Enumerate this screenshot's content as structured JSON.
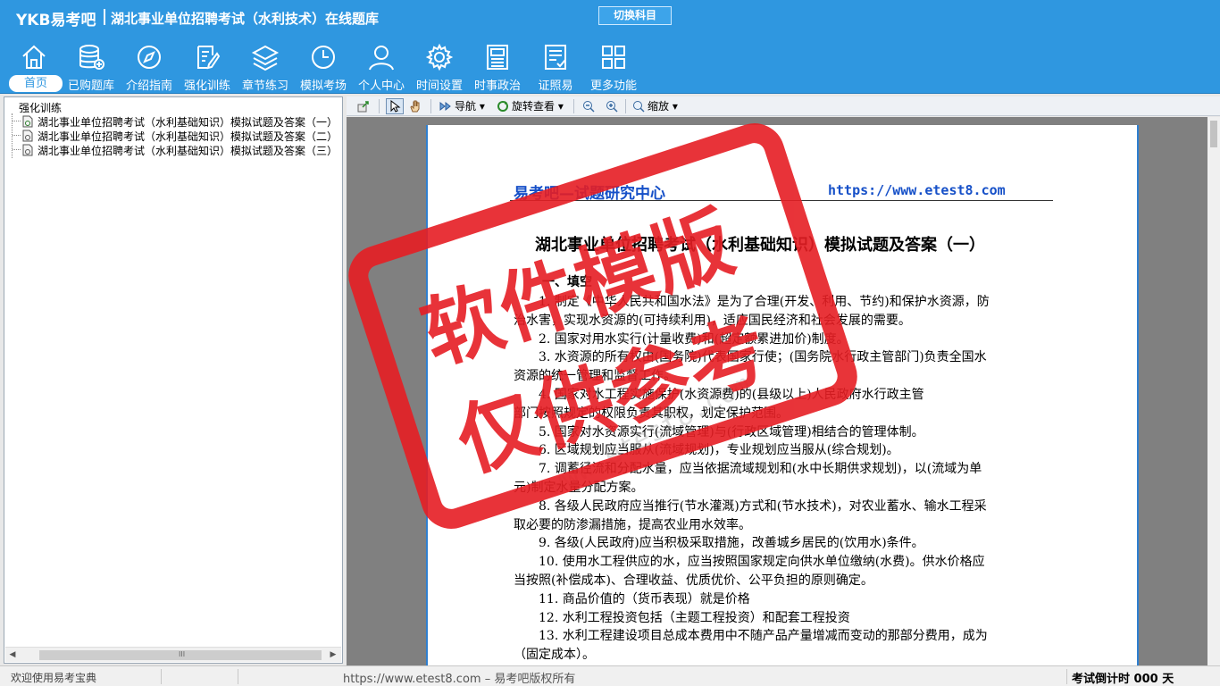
{
  "app": {
    "logo": "YKB易考吧",
    "title": "湖北事业单位招聘考试（水利技术）在线题库",
    "switch_button": "切换科目"
  },
  "nav": [
    {
      "label": "首页",
      "icon": "home-icon",
      "active": true
    },
    {
      "label": "已购题库",
      "icon": "database-icon"
    },
    {
      "label": "介绍指南",
      "icon": "compass-icon"
    },
    {
      "label": "强化训练",
      "icon": "edit-icon"
    },
    {
      "label": "章节练习",
      "icon": "layers-icon"
    },
    {
      "label": "模拟考场",
      "icon": "clock-icon"
    },
    {
      "label": "个人中心",
      "icon": "user-icon"
    },
    {
      "label": "时间设置",
      "icon": "gear-icon"
    },
    {
      "label": "时事政治",
      "icon": "news-icon"
    },
    {
      "label": "证照易",
      "icon": "checklist-icon"
    },
    {
      "label": "更多功能",
      "icon": "grid-icon"
    }
  ],
  "tree": {
    "root": "强化训练",
    "items": [
      "湖北事业单位招聘考试（水利基础知识）模拟试题及答案（一）",
      "湖北事业单位招聘考试（水利基础知识）模拟试题及答案（二）",
      "湖北事业单位招聘考试（水利基础知识）模拟试题及答案（三）"
    ],
    "scroll_grip": "III"
  },
  "viewer_toolbar": {
    "nav_label": "导航",
    "rotate_label": "旋转查看",
    "zoom_label": "缩放"
  },
  "document": {
    "brand": "易考吧—试题研究中心",
    "url": "https://www.etest8.com",
    "title": "湖北事业单位招聘考试（水利基础知识）模拟试题及答案（一）",
    "section": "一、填空",
    "lines": [
      {
        "text": "1. 制定《中华人民共和国水法》是为了合理(开发、利用、节约)和保护水资源，防",
        "indent": true
      },
      {
        "text": "治水害，实现水资源的(可持续利用)，适应国民经济和社会发展的需要。",
        "indent": false
      },
      {
        "text": "2. 国家对用水实行(计量收费)和(超定额累进加价)制度。",
        "indent": true
      },
      {
        "text": "3. 水资源的所有权由(国务院)代表国家行使；(国务院水行政主管部门)负责全国水",
        "indent": true
      },
      {
        "text": "资源的统一管理和监督工作。",
        "indent": false
      },
      {
        "text": "4. 国家对水工程实施保护(水资源费)的(县级以上)人民政府水行政主管",
        "indent": true
      },
      {
        "text": "部门按照规定的权限负责其职权，划定保护范围。",
        "indent": false
      },
      {
        "text": "5. 国家对水资源实行(流域管理)与(行政区域管理)相结合的管理体制。",
        "indent": true
      },
      {
        "text": "6. 区域规划应当服从(流域规划)，专业规划应当服从(综合规划)。",
        "indent": true
      },
      {
        "text": "7. 调蓄径流和分配水量，应当依据流域规划和(水中长期供求规划)，以(流域为单",
        "indent": true
      },
      {
        "text": "元)制定水量分配方案。",
        "indent": false
      },
      {
        "text": "8. 各级人民政府应当推行(节水灌溉)方式和(节水技术)，对农业蓄水、输水工程采",
        "indent": true
      },
      {
        "text": "取必要的防渗漏措施，提高农业用水效率。",
        "indent": false
      },
      {
        "text": "9. 各级(人民政府)应当积极采取措施，改善城乡居民的(饮用水)条件。",
        "indent": true
      },
      {
        "text": "10. 使用水工程供应的水，应当按照国家规定向供水单位缴纳(水费)。供水价格应",
        "indent": true
      },
      {
        "text": "当按照(补偿成本)、合理收益、优质优价、公平负担的原则确定。",
        "indent": false
      },
      {
        "text": "11.  商品价值的（货币表现）就是价格",
        "indent": true
      },
      {
        "text": "12.  水利工程投资包括（主题工程投资）和配套工程投资",
        "indent": true
      },
      {
        "text": "13.  水利工程建设项目总成本费用中不随产品产量增减而变动的那部分费用，成为",
        "indent": true
      },
      {
        "text": "（固定成本）。",
        "indent": false
      }
    ]
  },
  "watermark": {
    "stamp_line1": "软件模版",
    "stamp_line2": "仅供参考",
    "faint_url": "www.etest8.com"
  },
  "status": {
    "welcome": "欢迎使用易考宝典",
    "copyright": "https://www.etest8.com – 易考吧版权所有",
    "timer": "考试倒计时 000 天"
  },
  "colors": {
    "brand_blue": "#2f97e0",
    "stamp_red": "#e61e24",
    "doc_link_blue": "#1650c8"
  }
}
